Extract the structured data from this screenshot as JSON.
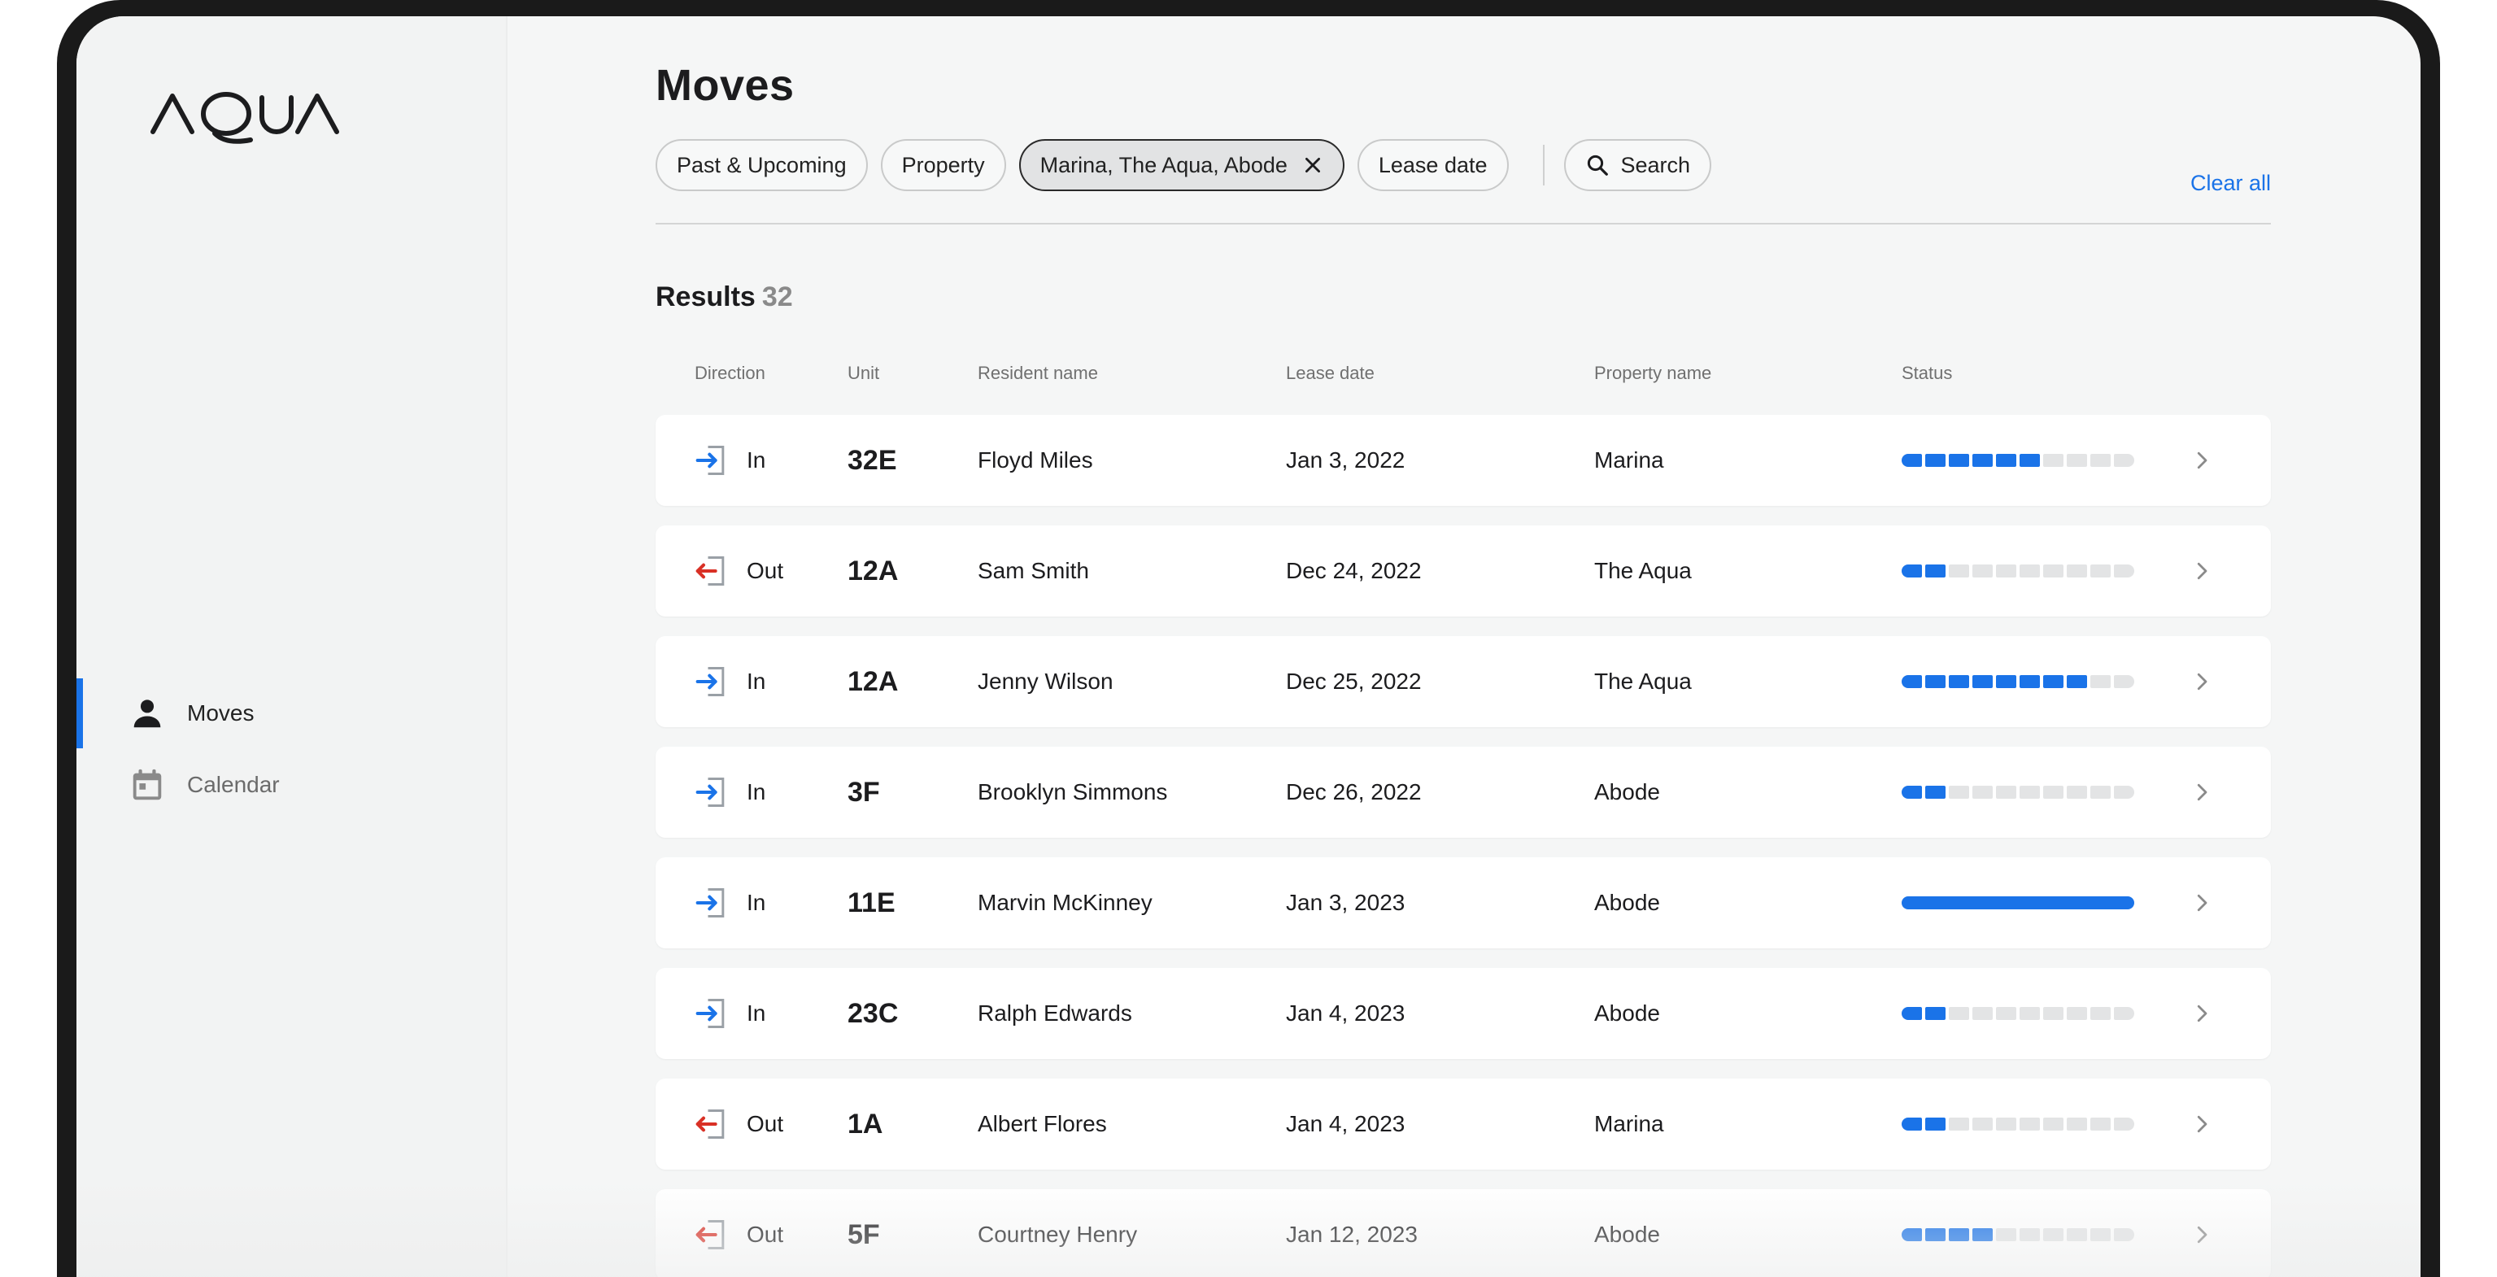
{
  "app": {
    "brand": "AQUA"
  },
  "sidebar": {
    "items": [
      {
        "label": "Moves",
        "icon": "person-icon",
        "active": true
      },
      {
        "label": "Calendar",
        "icon": "calendar-icon",
        "active": false
      }
    ]
  },
  "page": {
    "title": "Moves",
    "filters": {
      "time": "Past & Upcoming",
      "property": "Property",
      "selected_properties": "Marina, The Aqua, Abode",
      "lease_date": "Lease date",
      "search": "Search",
      "clear_all": "Clear all"
    },
    "results": {
      "label": "Results",
      "count": "32"
    }
  },
  "table": {
    "columns": [
      "Direction",
      "Unit",
      "Resident name",
      "Lease date",
      "Property name",
      "Status"
    ],
    "rows": [
      {
        "direction": "In",
        "unit": "32E",
        "resident": "Floyd Miles",
        "lease_date": "Jan 3, 2022",
        "property": "Marina",
        "progress": 0.6
      },
      {
        "direction": "Out",
        "unit": "12A",
        "resident": "Sam Smith",
        "lease_date": "Dec 24, 2022",
        "property": "The Aqua",
        "progress": 0.2
      },
      {
        "direction": "In",
        "unit": "12A",
        "resident": "Jenny Wilson",
        "lease_date": "Dec 25, 2022",
        "property": "The Aqua",
        "progress": 0.8
      },
      {
        "direction": "In",
        "unit": "3F",
        "resident": "Brooklyn Simmons",
        "lease_date": "Dec 26, 2022",
        "property": "Abode",
        "progress": 0.2
      },
      {
        "direction": "In",
        "unit": "11E",
        "resident": "Marvin McKinney",
        "lease_date": "Jan 3, 2023",
        "property": "Abode",
        "progress": 1.0
      },
      {
        "direction": "In",
        "unit": "23C",
        "resident": "Ralph Edwards",
        "lease_date": "Jan 4, 2023",
        "property": "Abode",
        "progress": 0.2
      },
      {
        "direction": "Out",
        "unit": "1A",
        "resident": "Albert Flores",
        "lease_date": "Jan 4, 2023",
        "property": "Marina",
        "progress": 0.2
      },
      {
        "direction": "Out",
        "unit": "5F",
        "resident": "Courtney Henry",
        "lease_date": "Jan 12, 2023",
        "property": "Abode",
        "progress": 0.4
      }
    ]
  },
  "colors": {
    "accent": "#1a73e8",
    "move_in": "#1a73e8",
    "move_out": "#d93025",
    "track": "#e3e4e5"
  }
}
